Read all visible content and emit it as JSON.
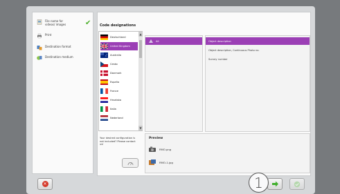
{
  "steps": [
    {
      "label": "File name for videos/ images"
    },
    {
      "label": "Print"
    },
    {
      "label": "Destination format"
    },
    {
      "label": "Destination medium"
    }
  ],
  "title": "Code designations",
  "languages": [
    {
      "label": "Deutschland",
      "selected": false
    },
    {
      "label": "United Kingdom",
      "selected": true
    },
    {
      "label": "Australia",
      "selected": false
    },
    {
      "label": "Cesko",
      "selected": false
    },
    {
      "label": "Danmark",
      "selected": false
    },
    {
      "label": "España",
      "selected": false
    },
    {
      "label": "France",
      "selected": false
    },
    {
      "label": "Hrvatska",
      "selected": false
    },
    {
      "label": "Italia",
      "selected": false
    },
    {
      "label": "Nederland",
      "selected": false
    }
  ],
  "column2": {
    "items": [
      {
        "label": "All",
        "selected": true
      }
    ]
  },
  "column3": {
    "items": [
      {
        "label": "Object description",
        "selected": true
      },
      {
        "label": "Object description, Continuous Photo no.",
        "selected": false
      },
      {
        "label": "Survey number",
        "selected": false
      }
    ]
  },
  "info_text": "Your desired configuration is not included? Please contact us!",
  "preview": {
    "title": "Preview",
    "items": [
      {
        "label": "RMO.png"
      },
      {
        "label": "RMO-1.jpg"
      }
    ]
  },
  "callout_number": "1",
  "colors": {
    "accent": "#9b3fb5",
    "check": "#4caf2a",
    "cancel": "#d53a2b"
  }
}
